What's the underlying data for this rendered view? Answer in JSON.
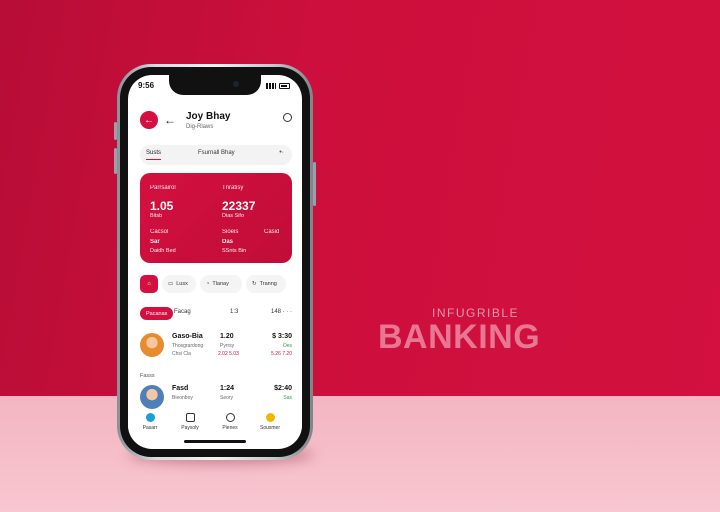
{
  "status_bar": {
    "time": "9:56"
  },
  "header": {
    "logo_glyph": "←",
    "back_glyph": "←",
    "title": "Joy Bhay",
    "subtitle": "Dig-Rlaws"
  },
  "tabs": {
    "first": "Susts",
    "second": "Fsurnall Bhay",
    "more": "•·"
  },
  "card": {
    "left_label": "Parrsairol",
    "left_value": "1.05",
    "left_caption": "Bitsb",
    "right_label": "Tnratisy",
    "right_value": "22337",
    "right_caption": "Dias Sifo",
    "bottom_left_label": "Cacsol",
    "bottom_left_value": "Sar",
    "bottom_left_caption": "Daidh Bed",
    "bottom_mid_label": "Sioeis",
    "bottom_mid_value": "Das",
    "bottom_mid_caption": "SSnts Bin",
    "bottom_right_label": "Casid"
  },
  "chips": [
    {
      "label": "",
      "icon": "home-icon"
    },
    {
      "label": "Lusx",
      "icon": "card-icon"
    },
    {
      "label": "Tlanay",
      "icon": "bell-icon"
    },
    {
      "label": "Tranng",
      "icon": "refresh-icon"
    }
  ],
  "filters": {
    "active": "Pacanas",
    "second": "Facag",
    "mid": "1:3",
    "right": "148 · · ·"
  },
  "transactions": [
    {
      "name": "Gaso-Bia",
      "sub1": "Thosgrardong",
      "sub2": "Chsi Cla",
      "mid": "1.20",
      "mid_sub": "Pyrrsy",
      "mid_red": "2.02 5.03",
      "amount": "$ 3:30",
      "amount_sub": "Oes",
      "amount_red": "5.26 7.20"
    },
    {
      "name": "Fasd",
      "sub1": "Bieonboy",
      "sub2": "",
      "mid": "1:24",
      "mid_sub": "Seory",
      "mid_red": "",
      "amount": "$2:40",
      "amount_sub": "Sas",
      "amount_red": ""
    }
  ],
  "section_label": "Fasss",
  "nav": [
    {
      "label": "Pasarr",
      "icon": "home-icon",
      "color": "#1a9ed6"
    },
    {
      "label": "Paysoly",
      "icon": "wallet-icon",
      "color": "#333333"
    },
    {
      "label": "Pienes",
      "icon": "clock-icon",
      "color": "#333333"
    },
    {
      "label": "Sousmer",
      "icon": "smile-icon",
      "color": "#f2b600"
    }
  ],
  "brand": {
    "small": "INFUGRIBLE",
    "big": "BANKING"
  },
  "colors": {
    "accent": "#d3103f",
    "background": "#c8103b",
    "floor": "#f6c0cc"
  }
}
